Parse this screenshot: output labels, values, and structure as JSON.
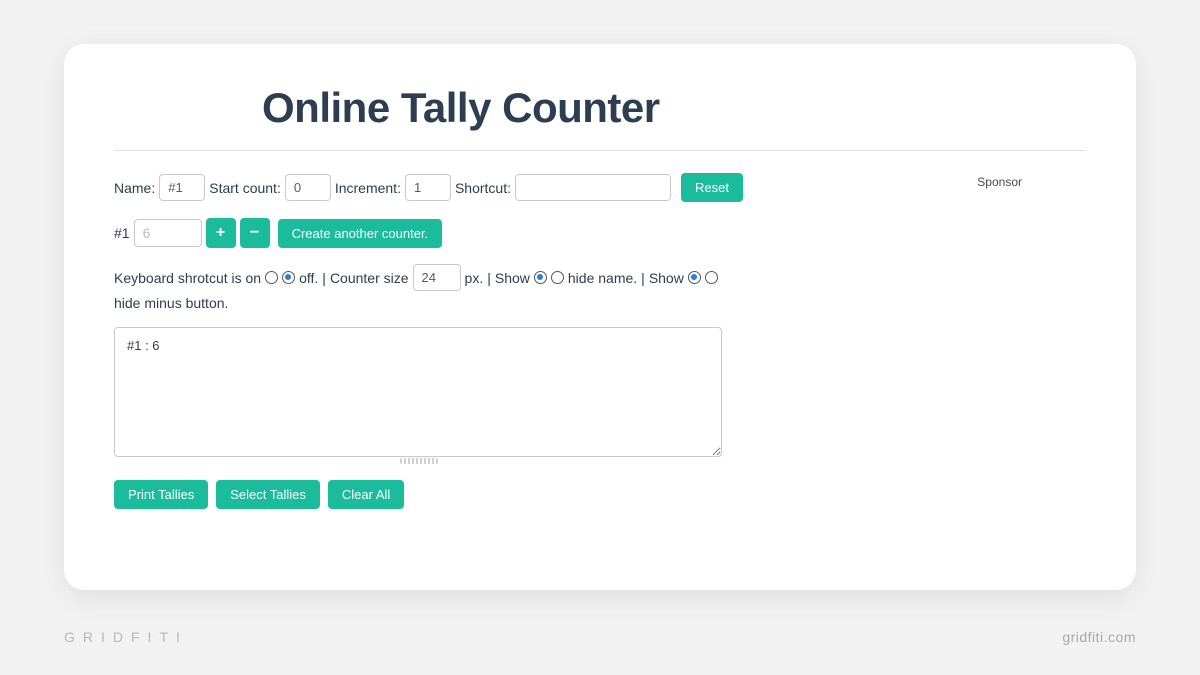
{
  "page": {
    "title": "Online Tally Counter"
  },
  "config": {
    "name_label": "Name:",
    "name_value": "#1",
    "start_label": "Start count:",
    "start_value": "0",
    "increment_label": "Increment:",
    "increment_value": "1",
    "shortcut_label": "Shortcut:",
    "shortcut_value": "",
    "reset_label": "Reset"
  },
  "counter": {
    "name": "#1",
    "value": "6",
    "plus_label": "+",
    "minus_label": "−",
    "create_label": "Create another counter."
  },
  "options": {
    "ks_prefix": "Keyboard shrotcut is on",
    "ks_suffix": "off.",
    "sep": " | ",
    "size_prefix": "Counter size",
    "size_value": "24",
    "size_suffix": "px.",
    "show_name_prefix": "Show",
    "show_name_suffix": "hide name.",
    "show_minus_prefix": "Show",
    "show_minus_suffix": "hide minus button."
  },
  "results": {
    "text": "#1 : 6"
  },
  "actions": {
    "print": "Print Tallies",
    "select": "Select Tallies",
    "clear": "Clear All"
  },
  "sidebar": {
    "sponsor": "Sponsor"
  },
  "footer": {
    "brand": "GRIDFITI",
    "url": "gridfiti.com"
  }
}
